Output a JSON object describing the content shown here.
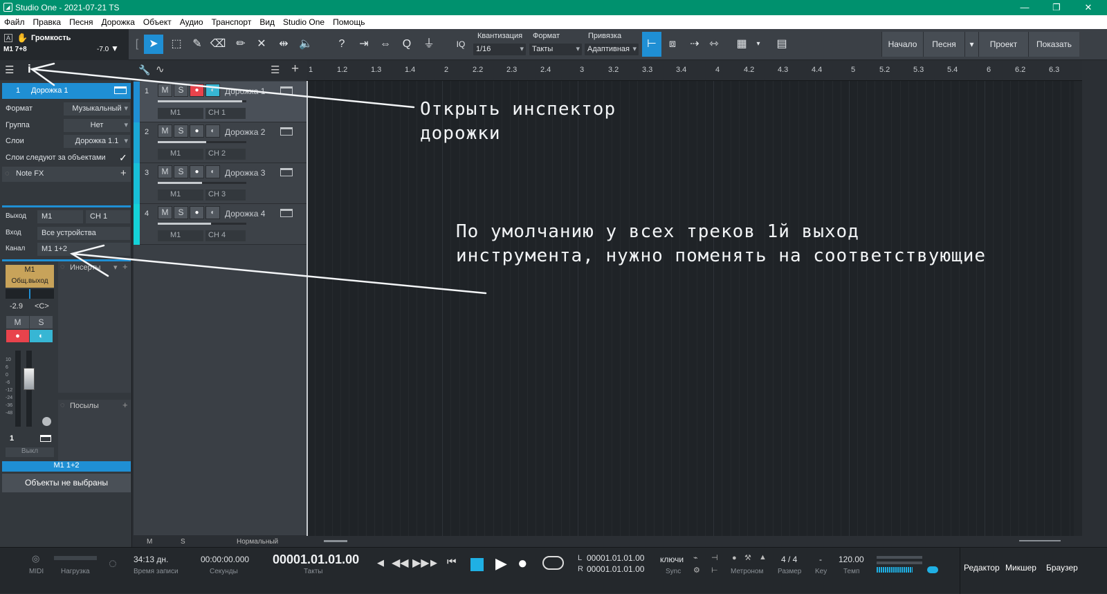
{
  "window": {
    "title": "Studio One - 2021-07-21 TS",
    "minimize": "—",
    "restore": "❐",
    "close": "✕"
  },
  "menu": [
    "Файл",
    "Правка",
    "Песня",
    "Дорожка",
    "Объект",
    "Аудио",
    "Транспорт",
    "Вид",
    "Studio One",
    "Помощь"
  ],
  "volume_panel": {
    "label": "Громкость",
    "track": "M1 7+8",
    "value": "-7.0"
  },
  "toolbar": {
    "quantize_label": "Квантизация",
    "quantize_value": "1/16",
    "format_label": "Формат",
    "format_value": "Такты",
    "snap_label": "Привязка",
    "snap_value": "Адаптивная",
    "iq": "IQ",
    "nav": [
      "Начало",
      "Песня",
      "Проект",
      "Показать"
    ]
  },
  "inspector": {
    "track_number": "1",
    "track_name": "Дорожка 1",
    "rows": [
      {
        "label": "Формат",
        "value": "Музыкальный"
      },
      {
        "label": "Группа",
        "value": "Нет"
      },
      {
        "label": "Слои",
        "value": "Дорожка 1.1"
      }
    ],
    "layers_follow": "Слои следуют за объектами",
    "note_fx": "Note FX",
    "output_label": "Выход",
    "output_value": "M1",
    "output_ch": "CH 1",
    "input_label": "Вход",
    "input_value": "Все устройства",
    "channel_label": "Канал",
    "channel_value": "M1 1+2",
    "channel_name": "M1",
    "channel_out": "Общ.выход",
    "channel_db": "-2.9",
    "channel_pan": "<C>",
    "m": "M",
    "s": "S",
    "inserts": "Инсерты",
    "sends": "Посылы",
    "scale": [
      "10",
      "6",
      "0",
      "-6",
      "-12",
      "-24",
      "-36",
      "-48"
    ],
    "strip_number": "1",
    "off": "Выкл",
    "bottom_channel": "M1 1+2",
    "no_objects": "Объекты не выбраны"
  },
  "tracks": [
    {
      "num": "1",
      "name": "Дорожка 1",
      "out": "M1",
      "ch": "CH 1",
      "color": "#1f8fd4",
      "selected": true,
      "armed": true,
      "level": 0.95
    },
    {
      "num": "2",
      "name": "Дорожка 2",
      "out": "M1",
      "ch": "CH 2",
      "color": "#1ba8d6",
      "selected": false,
      "armed": false,
      "level": 0.55
    },
    {
      "num": "3",
      "name": "Дорожка 3",
      "out": "M1",
      "ch": "CH 3",
      "color": "#18c0d8",
      "selected": false,
      "armed": false,
      "level": 0.5
    },
    {
      "num": "4",
      "name": "Дорожка 4",
      "out": "M1",
      "ch": "CH 4",
      "color": "#14d2d8",
      "selected": false,
      "armed": false,
      "level": 0.6
    }
  ],
  "ruler": [
    "1",
    "1.2",
    "1.3",
    "1.4",
    "2",
    "2.2",
    "2.3",
    "2.4",
    "3",
    "3.2",
    "3.3",
    "3.4",
    "4",
    "4.2",
    "4.3",
    "4.4",
    "5",
    "5.2",
    "5.3",
    "5.4",
    "6",
    "6.2",
    "6.3"
  ],
  "tracklist_footer": {
    "m": "M",
    "s": "S",
    "mode": "Нормальный"
  },
  "annotations": {
    "inspector": [
      "Открыть инспектор",
      "дорожки"
    ],
    "outputs": [
      "По умолчанию у всех треков 1й выход",
      "инструмента, нужно поменять на соответствующие"
    ]
  },
  "transport": {
    "midi": "MIDI",
    "load": "Нагрузка",
    "record_time": "34:13 дн.",
    "record_time_label": "Время записи",
    "seconds": "00:00:00.000",
    "seconds_label": "Секунды",
    "bars": "00001.01.01.00",
    "bars_label": "Такты",
    "loop_l": "00001.01.01.00",
    "loop_r": "00001.01.01.00",
    "sync": "ключи",
    "sync_label": "Sync",
    "metronome_label": "Метроном",
    "signature": "4 / 4",
    "signature_label": "Размер",
    "key": "-",
    "key_label": "Key",
    "tempo": "120.00",
    "tempo_label": "Темп",
    "views": [
      "Редактор",
      "Микшер",
      "Браузер"
    ],
    "L": "L",
    "R": "R"
  }
}
